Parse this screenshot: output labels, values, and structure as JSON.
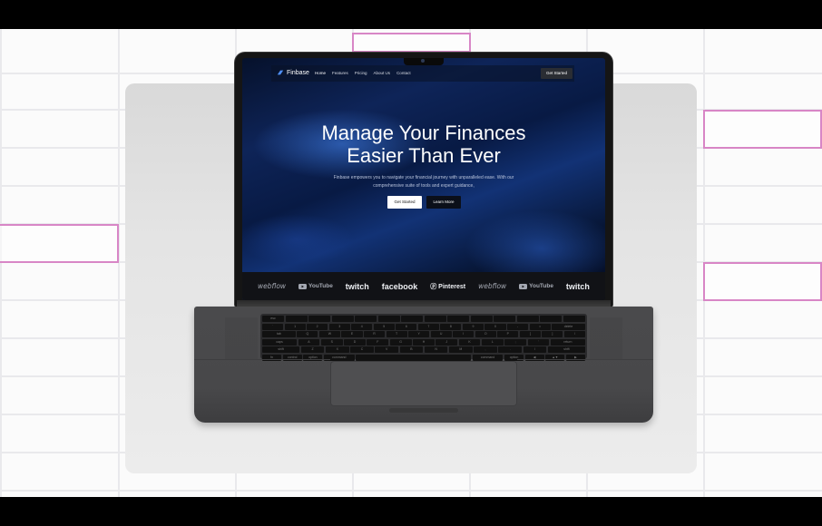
{
  "website": {
    "brand": "Finbase",
    "nav": [
      {
        "label": "Home",
        "active": true
      },
      {
        "label": "Features",
        "active": false
      },
      {
        "label": "Pricing",
        "active": false
      },
      {
        "label": "About Us",
        "active": false
      },
      {
        "label": "Contact",
        "active": false
      }
    ],
    "nav_cta": "Get Started",
    "hero": {
      "title_line1": "Manage Your Finances",
      "title_line2": "Easier Than Ever",
      "subtitle": "Finbase empowers you to navigate your financial journey with unparalleled ease. With our comprehensive suite of tools and expert guidance,",
      "primary_button": "Get Started",
      "secondary_button": "Learn More"
    },
    "partner_logos": [
      "webflow",
      "YouTube",
      "twitch",
      "facebook",
      "Pinterest",
      "webflow",
      "YouTube",
      "twitch"
    ]
  },
  "keyboard_rows": [
    [
      "esc",
      "",
      "",
      "",
      "",
      "",
      "",
      "",
      "",
      "",
      "",
      "",
      "",
      ""
    ],
    [
      "`",
      "1",
      "2",
      "3",
      "4",
      "5",
      "6",
      "7",
      "8",
      "9",
      "0",
      "-",
      "=",
      "delete"
    ],
    [
      "tab",
      "Q",
      "W",
      "E",
      "R",
      "T",
      "Y",
      "U",
      "I",
      "O",
      "P",
      "[",
      "]",
      "\\"
    ],
    [
      "caps",
      "A",
      "S",
      "D",
      "F",
      "G",
      "H",
      "J",
      "K",
      "L",
      ";",
      "'",
      "return"
    ],
    [
      "shift",
      "Z",
      "X",
      "C",
      "V",
      "B",
      "N",
      "M",
      ",",
      ".",
      "/",
      "shift"
    ],
    [
      "fn",
      "control",
      "option",
      "command",
      "",
      "command",
      "option",
      "◀",
      "▲▼",
      "▶"
    ]
  ],
  "colors": {
    "accent_pink": "#d886c6",
    "screen_blue": "#0e2458",
    "aluminum": "#48484a"
  }
}
